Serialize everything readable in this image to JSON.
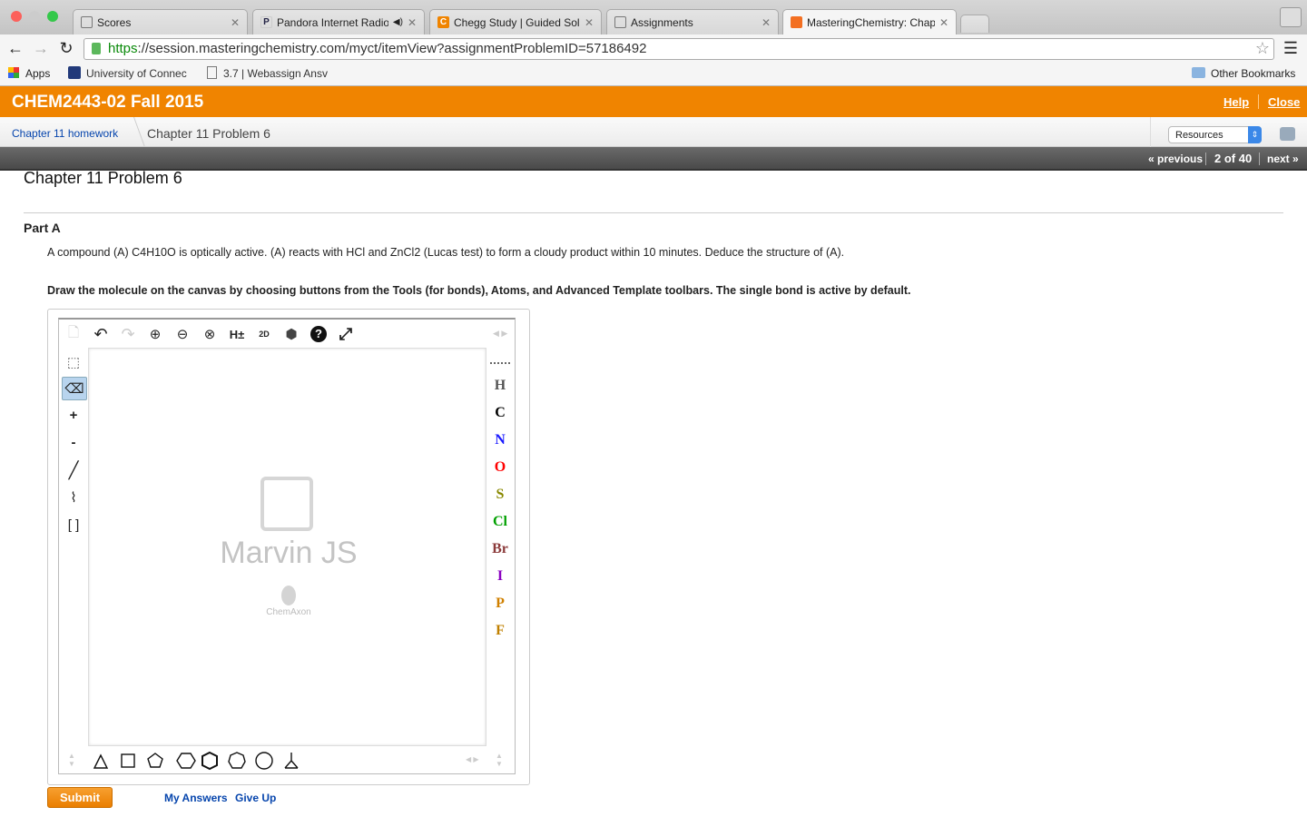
{
  "browser": {
    "tabs": [
      {
        "title": "Scores",
        "favicon": "page-icon"
      },
      {
        "title": "Pandora Internet Radio",
        "favicon": "P"
      },
      {
        "title": "Chegg Study | Guided Solu",
        "favicon": "C"
      },
      {
        "title": "Assignments",
        "favicon": "page-icon"
      },
      {
        "title": "MasteringChemistry: Chapt",
        "favicon": "mastering-icon"
      }
    ],
    "url_scheme": "https",
    "url_rest": "://session.masteringchemistry.com/myct/itemView?assignmentProblemID=57186492",
    "bookmarks": [
      {
        "label": "Apps"
      },
      {
        "label": "University of Connec"
      },
      {
        "label": "3.7 | Webassign Ansv"
      }
    ],
    "other_bookmarks": "Other Bookmarks"
  },
  "header": {
    "course": "CHEM2443-02 Fall 2015",
    "help": "Help",
    "close": "Close",
    "color": "#f08400"
  },
  "breadcrumb": {
    "parent": "Chapter 11 homework",
    "current": "Chapter 11 Problem 6",
    "resources": "Resources"
  },
  "nav": {
    "previous": "« previous",
    "position": "2 of 40",
    "next": "next »"
  },
  "problem": {
    "title": "Chapter 11 Problem 6",
    "part": "Part A",
    "question": "A compound (A) C4H10O is optically active. (A) reacts with HCl and ZnCl2 (Lucas test) to form a cloudy product within 10 minutes. Deduce the structure of (A).",
    "instructions": "Draw the molecule on the canvas by choosing buttons from the Tools (for bonds), Atoms, and Advanced Template toolbars. The single bond is active by default."
  },
  "marvin": {
    "logo": "Marvin JS",
    "vendor": "ChemAxon",
    "atoms": [
      {
        "symbol": "H",
        "color": "#555555"
      },
      {
        "symbol": "C",
        "color": "#000000"
      },
      {
        "symbol": "N",
        "color": "#1a1aff"
      },
      {
        "symbol": "O",
        "color": "#ff0000"
      },
      {
        "symbol": "S",
        "color": "#888800"
      },
      {
        "symbol": "Cl",
        "color": "#00a000"
      },
      {
        "symbol": "Br",
        "color": "#8b3a3a"
      },
      {
        "symbol": "I",
        "color": "#8a00c0"
      },
      {
        "symbol": "P",
        "color": "#d08000"
      },
      {
        "symbol": "F",
        "color": "#c08000"
      }
    ],
    "top_tools": [
      "new-document",
      "undo",
      "redo",
      "zoom-in",
      "zoom-out",
      "zoom-reset",
      "H±",
      "2D",
      "info",
      "help",
      "fullscreen"
    ],
    "left_tools": [
      "+",
      "-"
    ]
  },
  "actions": {
    "submit": "Submit",
    "my_answers": "My Answers",
    "give_up": "Give Up"
  }
}
